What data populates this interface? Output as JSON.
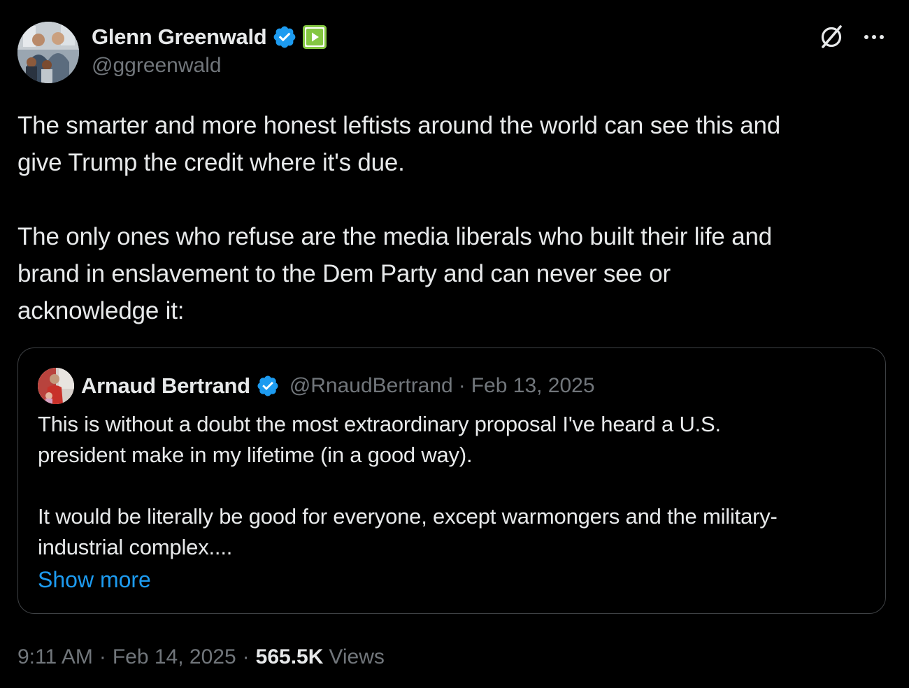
{
  "author": {
    "display_name": "Glenn Greenwald",
    "handle": "@ggreenwald",
    "verified_icon": "verified-badge-icon",
    "affiliate_icon": "rumble-icon"
  },
  "header_actions": {
    "grok_icon": "grok-icon",
    "more_icon": "more-options-icon"
  },
  "tweet": {
    "paragraphs": [
      {
        "lines": [
          "The smarter and more honest leftists around the world can see this and",
          "give Trump the credit where it's due."
        ]
      },
      {
        "lines": [
          "The only ones who refuse are the media liberals who built their life and",
          "brand in enslavement to the Dem Party and can never see or",
          "acknowledge it:"
        ]
      }
    ]
  },
  "quote": {
    "display_name": "Arnaud Bertrand",
    "handle": "@RnaudBertrand",
    "separator": "·",
    "date": "Feb 13, 2025",
    "paragraphs": [
      {
        "lines": [
          "This is without a doubt the most extraordinary proposal I've heard a U.S.",
          "president make in my lifetime (in a good way)."
        ]
      },
      {
        "lines": [
          "It would be literally be good for everyone, except warmongers and the military-",
          "industrial complex...."
        ]
      }
    ],
    "show_more_label": "Show more"
  },
  "footer": {
    "time": "9:11 AM",
    "separator": "·",
    "date": "Feb 14, 2025",
    "views_count": "565.5K",
    "views_label": "Views"
  },
  "colors": {
    "background": "#000000",
    "text_primary": "#e7e9ea",
    "text_secondary": "#71767b",
    "accent": "#1d9bf0",
    "card_border": "#3e4144",
    "rumble_green": "#85c742"
  }
}
